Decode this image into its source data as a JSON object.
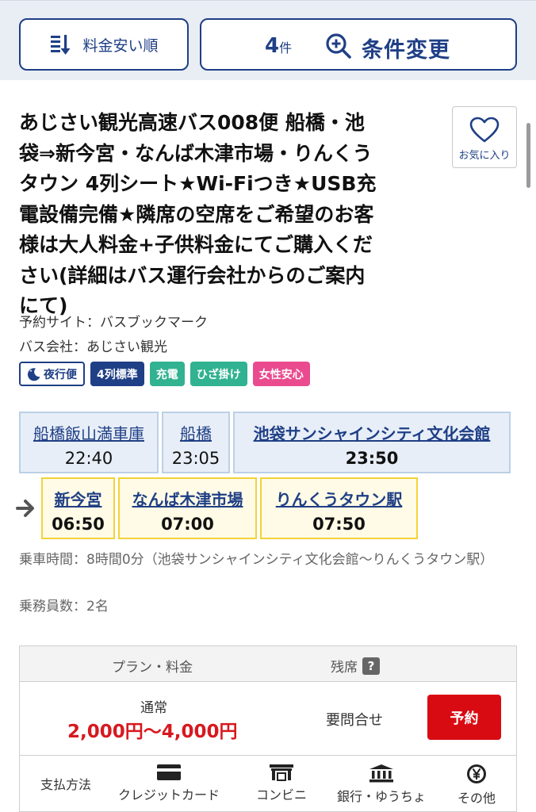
{
  "toolbar": {
    "sort_label": "料金安い順",
    "count": "4",
    "count_unit": "件",
    "condition_label": "条件変更"
  },
  "listing": {
    "title_lines": [
      "あじさい観光高速バス008便 船橋・池",
      "袋⇒新今宮・なんば木津市場・りんくう",
      "タウン 4列シート★Wi-Fiつき★USB充",
      "電設備完備★隣席の空席をご希望のお客",
      "様は大人料金+子供料金にてご購入くだ",
      "さい(詳細はバス運行会社からのご案内",
      "にて)"
    ],
    "favorite_label": "お気に入り",
    "booking_site": "予約サイト：バスブックマーク",
    "bus_company": "バス会社：あじさい観光",
    "tags": [
      {
        "label": "夜行便",
        "style": "night"
      },
      {
        "label": "4列標準",
        "style": "blue"
      },
      {
        "label": "充電",
        "style": "green"
      },
      {
        "label": "ひざ掛け",
        "style": "green"
      },
      {
        "label": "女性安心",
        "style": "pink"
      }
    ]
  },
  "boarding_stops": [
    {
      "name": "船橋飯山満車庫",
      "time": "22:40"
    },
    {
      "name": "船橋",
      "time": "23:05"
    },
    {
      "name": "池袋サンシャインシティ文化会館",
      "time": "23:50"
    }
  ],
  "alighting_stops": [
    {
      "name": "新今宮",
      "time": "06:50"
    },
    {
      "name": "なんば木津市場",
      "time": "07:00"
    },
    {
      "name": "りんくうタウン駅",
      "time": "07:50"
    }
  ],
  "trip_info": {
    "ride_time": "乗車時間：8時間0分（池袋サンシャインシティ文化会館〜りんくうタウン駅）",
    "crew": "乗務員数：2名"
  },
  "plan": {
    "header_plan": "プラン・料金",
    "header_seats": "残席",
    "help_mark": "?",
    "plan_name": "通常",
    "price": "2,000円〜4,000円",
    "availability": "要問合せ",
    "reserve_label": "予約",
    "payment_label": "支払方法",
    "payment_methods": [
      {
        "label": "クレジットカード",
        "icon": "credit-card-icon"
      },
      {
        "label": "コンビニ",
        "icon": "convenience-store-icon"
      },
      {
        "label": "銀行・ゆうちょ",
        "icon": "bank-icon"
      },
      {
        "label": "その他",
        "icon": "yen-icon"
      }
    ]
  },
  "colors": {
    "primary": "#1f3f86",
    "price_red": "#d7191f",
    "reserve_red": "#d90b12",
    "tag_green": "#31b291",
    "tag_pink": "#e94b8e",
    "stop_yellow_border": "#f2d23a"
  }
}
